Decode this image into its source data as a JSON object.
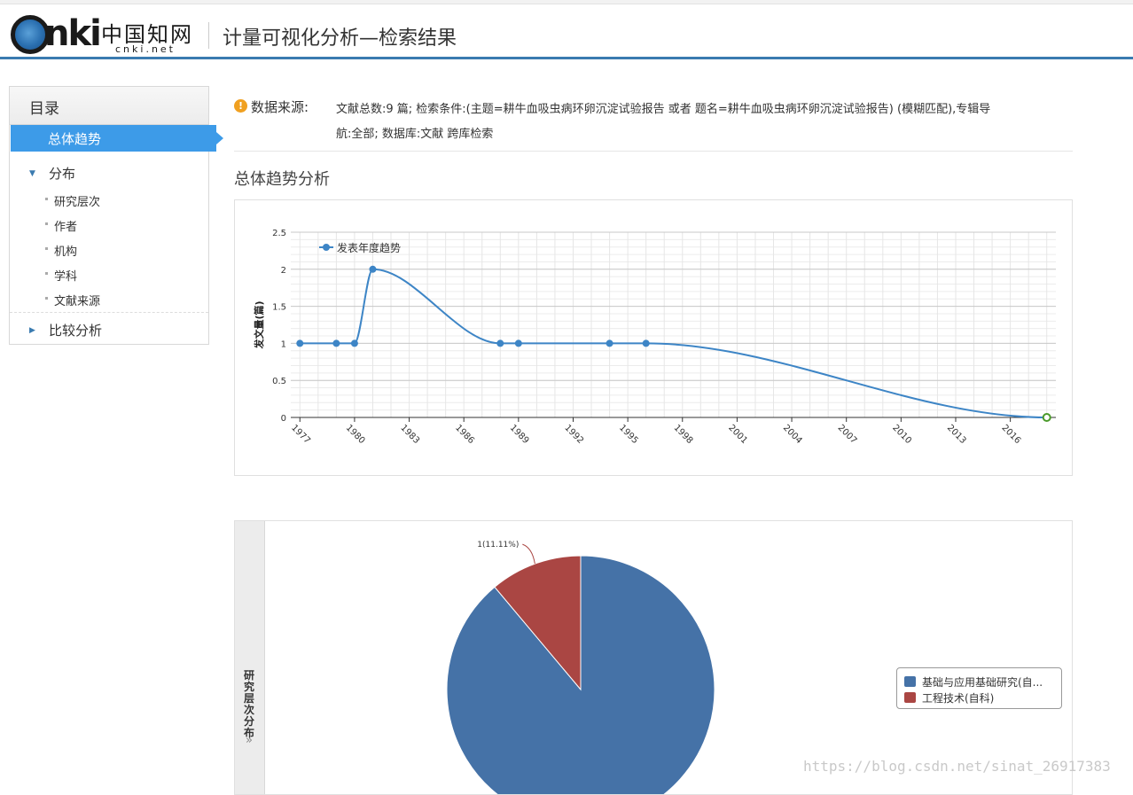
{
  "header": {
    "logo_text": "CNKi",
    "logo_cn": "中国知网",
    "logo_url": "cnki.net",
    "title": "计量可视化分析—检索结果"
  },
  "sidebar": {
    "heading": "目录",
    "active_item": "总体趋势",
    "groups": [
      {
        "label": "分布",
        "expanded": true,
        "items": [
          "研究层次",
          "作者",
          "机构",
          "学科",
          "文献来源"
        ]
      },
      {
        "label": "比较分析",
        "expanded": false,
        "items": []
      }
    ]
  },
  "info": {
    "label": "数据来源:",
    "line1": "文献总数:9 篇; 检索条件:(主题=耕牛血吸虫病环卵沉淀试验报告 或者 题名=耕牛血吸虫病环卵沉淀试验报告) (模糊匹配),专辑导",
    "line2": "航:全部; 数据库:文献 跨库检索"
  },
  "section_title": "总体趋势分析",
  "chart_data": [
    {
      "type": "line",
      "ylabel": "发文量(篇)",
      "xlabel": "",
      "xlim": [
        1976.5,
        2018.5
      ],
      "ylim": [
        0,
        2.5
      ],
      "x_ticks": [
        "1977",
        "1980",
        "1983",
        "1986",
        "1989",
        "1992",
        "1995",
        "1998",
        "2001",
        "2004",
        "2007",
        "2010",
        "2013",
        "2016"
      ],
      "y_ticks": [
        "0",
        "0.5",
        "1",
        "1.5",
        "2",
        "2.5"
      ],
      "legend": "top-left",
      "grid": true,
      "color": "#3d85c6",
      "series": [
        {
          "name": "发表年度趋势",
          "x": [
            1977,
            1979,
            1980,
            1981,
            1988,
            1989,
            1994,
            1996,
            2018
          ],
          "values": [
            1,
            1,
            1,
            2,
            1,
            1,
            1,
            1,
            0
          ]
        }
      ]
    },
    {
      "type": "pie",
      "title": "研究层次分布",
      "legend": "right",
      "slices": [
        {
          "label": "基础与应用基础研究(自...",
          "value": 8,
          "color": "#4572a7"
        },
        {
          "label": "工程技术(自科)",
          "value": 1,
          "color": "#aa4643",
          "data_label": "1(11.11%)"
        }
      ]
    }
  ],
  "pie_tab": {
    "label": "研究层次分布",
    "arrows": "»"
  },
  "watermark": "https://blog.csdn.net/sinat_26917383"
}
